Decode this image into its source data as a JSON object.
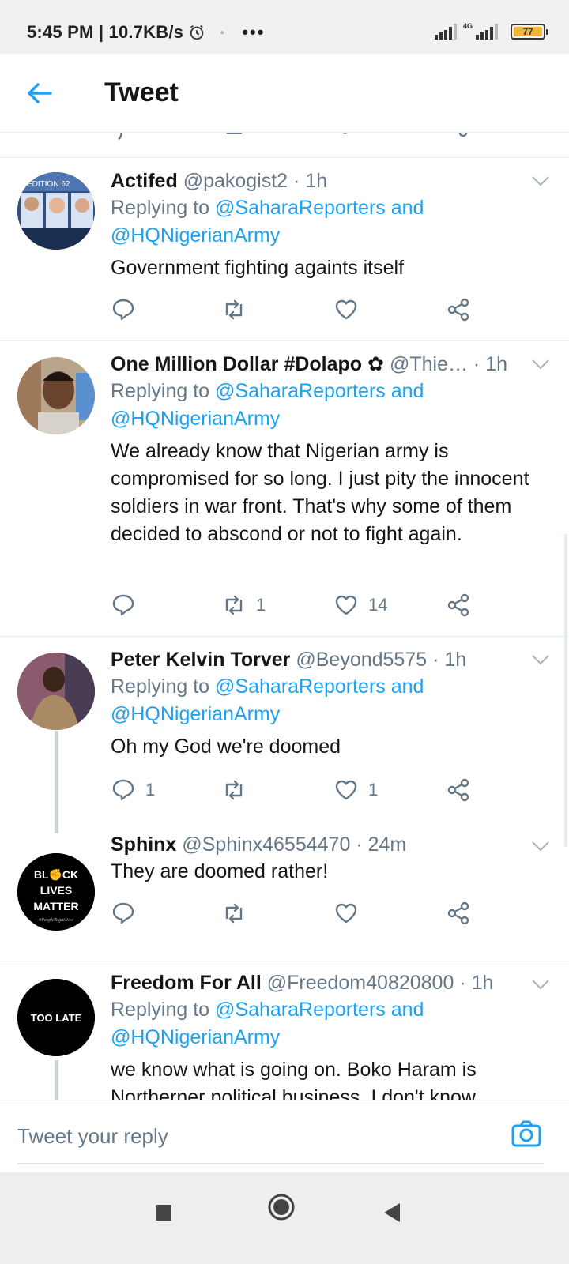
{
  "status_bar": {
    "time_speed": "5:45 PM | 10.7KB/s",
    "more": "•••",
    "network": "4G",
    "battery": "77"
  },
  "header": {
    "title": "Tweet"
  },
  "tweets": [
    {
      "name": "Actifed",
      "handle": "@pakogist2",
      "time": "· 1h",
      "replying_prefix": "Replying to ",
      "replying_links": "@SaharaReporters and",
      "replying_links2": "@HQNigerianArmy",
      "text": "Government fighting againts  itself",
      "replies": "",
      "retweets": "",
      "likes": ""
    },
    {
      "name": "One Million Dollar #Dolapo ✿",
      "handle": "@Thie…",
      "time": "· 1h",
      "replying_prefix": "Replying to ",
      "replying_links": "@SaharaReporters and",
      "replying_links2": "@HQNigerianArmy",
      "text": "We already know that Nigerian army is compromised for so long. I just pity the innocent soldiers in war front. That's why some of them decided to abscond or not to fight again.",
      "replies": "",
      "retweets": "1",
      "likes": "14"
    },
    {
      "name": "Peter Kelvin Torver",
      "handle": "@Beyond5575",
      "time": "· 1h",
      "replying_prefix": "Replying to ",
      "replying_links": "@SaharaReporters and",
      "replying_links2": "@HQNigerianArmy",
      "text": "Oh my God we're doomed",
      "replies": "1",
      "retweets": "",
      "likes": "1"
    },
    {
      "name": "Sphinx",
      "handle": "@Sphinx46554470",
      "time": "· 24m",
      "avatar_text": [
        "BL✊CK",
        "LIVES",
        "MATTER"
      ],
      "avatar_sub": "#PeopleRightNow",
      "text": "They are doomed rather!",
      "replies": "",
      "retweets": "",
      "likes": ""
    },
    {
      "name": "Freedom For All",
      "handle": "@Freedom40820800",
      "time": "· 1h",
      "avatar_text": "TOO LATE",
      "replying_prefix": "Replying to ",
      "replying_links": "@SaharaReporters and",
      "replying_links2": "@HQNigerianArmy",
      "text": "we know what is going on. Boko Haram is Northerner political business. I don't know"
    }
  ],
  "avatar_one_text": "EDITION 62",
  "reply_bar": {
    "placeholder": "Tweet your reply"
  },
  "colors": {
    "link": "#1da1f2",
    "muted": "#657786",
    "text": "#14171a"
  }
}
